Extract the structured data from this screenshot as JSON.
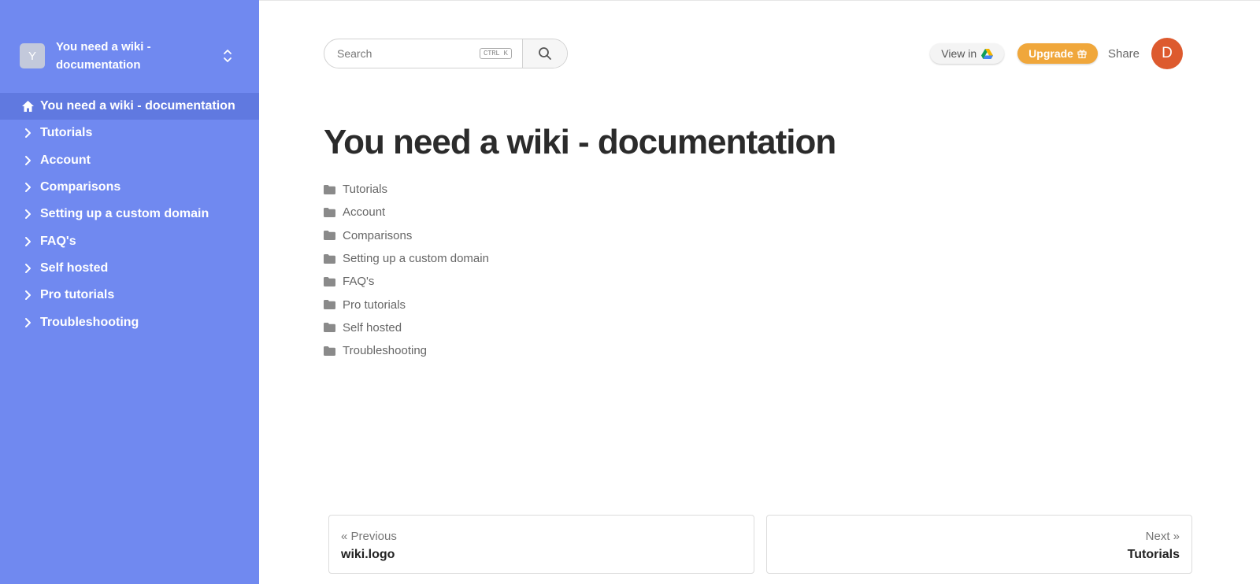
{
  "space": {
    "avatar_letter": "Y",
    "name": "You need a wiki - documentation"
  },
  "sidebar": {
    "home": {
      "label": "You need a wiki - documentation"
    },
    "items": [
      {
        "label": "Tutorials"
      },
      {
        "label": "Account"
      },
      {
        "label": "Comparisons"
      },
      {
        "label": "Setting up a custom domain"
      },
      {
        "label": "FAQ's"
      },
      {
        "label": "Self hosted"
      },
      {
        "label": "Pro tutorials"
      },
      {
        "label": "Troubleshooting"
      }
    ]
  },
  "search": {
    "placeholder": "Search",
    "shortcut": "CTRL K"
  },
  "toolbar": {
    "view_in_label": "View in",
    "upgrade_label": "Upgrade",
    "share_label": "Share",
    "user_initial": "D"
  },
  "page": {
    "title": "You need a wiki - documentation",
    "children": [
      {
        "label": "Tutorials"
      },
      {
        "label": "Account"
      },
      {
        "label": "Comparisons"
      },
      {
        "label": "Setting up a custom domain"
      },
      {
        "label": "FAQ's"
      },
      {
        "label": "Pro tutorials"
      },
      {
        "label": "Self hosted"
      },
      {
        "label": "Troubleshooting"
      }
    ]
  },
  "pager": {
    "prev_hint": "« Previous",
    "prev_title": "wiki.logo",
    "next_hint": "Next »",
    "next_title": "Tutorials"
  },
  "colors": {
    "sidebar": "#7089f0",
    "sidebar_active": "#6079e0",
    "upgrade": "#f0a73b",
    "avatar": "#dd5a2e"
  },
  "icons": {
    "home": "home-icon",
    "chevron": "chevron-right-icon",
    "folder": "folder-icon",
    "search": "search-icon",
    "drive": "google-drive-icon",
    "gift": "gift-icon",
    "switcher": "chevron-up-down-icon"
  }
}
